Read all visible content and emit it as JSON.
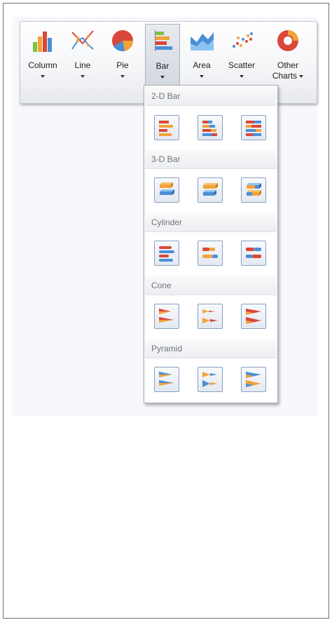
{
  "ribbon": {
    "buttons": [
      {
        "label": "Column",
        "icon": "column-chart-icon"
      },
      {
        "label": "Line",
        "icon": "line-chart-icon"
      },
      {
        "label": "Pie",
        "icon": "pie-chart-icon"
      },
      {
        "label": "Bar",
        "icon": "bar-chart-icon",
        "active": true
      },
      {
        "label": "Area",
        "icon": "area-chart-icon"
      },
      {
        "label": "Scatter",
        "icon": "scatter-chart-icon"
      },
      {
        "label_line1": "Other",
        "label_line2": "Charts",
        "icon": "other-charts-icon"
      }
    ]
  },
  "gallery": {
    "groups": [
      {
        "title": "2-D Bar",
        "items": [
          "clustered-bar",
          "stacked-bar",
          "full-stacked-bar"
        ]
      },
      {
        "title": "3-D Bar",
        "items": [
          "clustered-bar-3d",
          "stacked-bar-3d",
          "full-stacked-bar-3d"
        ]
      },
      {
        "title": "Cylinder",
        "items": [
          "clustered-cylinder",
          "stacked-cylinder",
          "full-stacked-cylinder"
        ]
      },
      {
        "title": "Cone",
        "items": [
          "clustered-cone",
          "stacked-cone",
          "full-stacked-cone"
        ]
      },
      {
        "title": "Pyramid",
        "items": [
          "clustered-pyramid",
          "stacked-pyramid",
          "full-stacked-pyramid"
        ]
      }
    ]
  },
  "colors": {
    "accent_red": "#d9473a",
    "accent_orange": "#f2a33a",
    "accent_blue": "#4a8fd6",
    "accent_green": "#7fc241",
    "selection_border": "#8aa0bd"
  }
}
